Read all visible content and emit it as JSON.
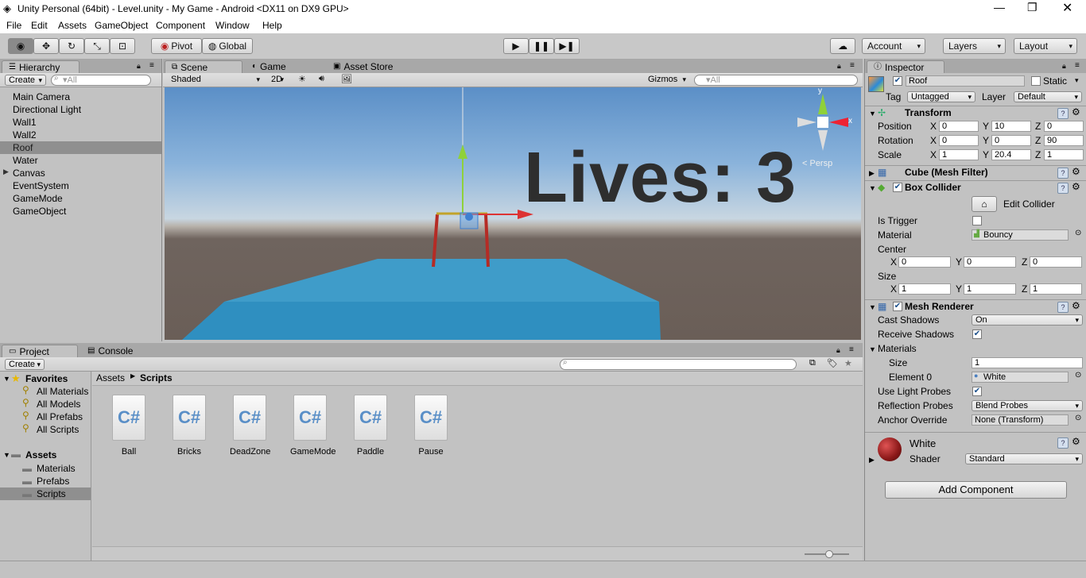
{
  "window": {
    "title": "Unity Personal (64bit) - Level.unity - My Game - Android <DX11 on DX9 GPU>"
  },
  "menu": [
    "File",
    "Edit",
    "Assets",
    "GameObject",
    "Component",
    "Window",
    "Help"
  ],
  "toolbar": {
    "pivot": "Pivot",
    "global": "Global",
    "account": "Account",
    "layers": "Layers",
    "layout": "Layout"
  },
  "hierarchy": {
    "tab": "Hierarchy",
    "create": "Create",
    "search_placeholder": "▾All",
    "items": [
      "Main Camera",
      "Directional Light",
      "Wall1",
      "Wall2",
      "Roof",
      "Water",
      "Canvas",
      "EventSystem",
      "GameMode",
      "GameObject"
    ],
    "selected": "Roof"
  },
  "scene": {
    "tabs": [
      "Scene",
      "Game",
      "Asset Store"
    ],
    "shading": "Shaded",
    "mode_2d": "2D",
    "gizmos": "Gizmos",
    "search_placeholder": "▾All",
    "overlay_text": "Lives: 3",
    "persp": "< Persp",
    "axes": {
      "y": "y",
      "x": "x"
    }
  },
  "project": {
    "tabs": [
      "Project",
      "Console"
    ],
    "create": "Create",
    "favorites_label": "Favorites",
    "favorites": [
      "All Materials",
      "All Models",
      "All Prefabs",
      "All Scripts"
    ],
    "assets_label": "Assets",
    "assets": [
      "Materials",
      "Prefabs",
      "Scripts"
    ],
    "breadcrumb": [
      "Assets",
      "Scripts"
    ],
    "files": [
      "Ball",
      "Bricks",
      "DeadZone",
      "GameMode",
      "Paddle",
      "Pause"
    ],
    "file_glyph": "C#"
  },
  "inspector": {
    "tab": "Inspector",
    "name": "Roof",
    "static": "Static",
    "tag_label": "Tag",
    "tag": "Untagged",
    "layer_label": "Layer",
    "layer": "Default",
    "transform": {
      "title": "Transform",
      "rows": [
        {
          "label": "Position",
          "x": "0",
          "y": "10",
          "z": "0"
        },
        {
          "label": "Rotation",
          "x": "0",
          "y": "0",
          "z": "90"
        },
        {
          "label": "Scale",
          "x": "1",
          "y": "20.4",
          "z": "1"
        }
      ]
    },
    "mesh_filter": "Cube (Mesh Filter)",
    "box_collider": {
      "title": "Box Collider",
      "edit": "Edit Collider",
      "is_trigger": "Is Trigger",
      "material_label": "Material",
      "material": "Bouncy",
      "center_label": "Center",
      "center": {
        "x": "0",
        "y": "0",
        "z": "0"
      },
      "size_label": "Size",
      "size": {
        "x": "1",
        "y": "1",
        "z": "1"
      }
    },
    "mesh_renderer": {
      "title": "Mesh Renderer",
      "cast_shadows_label": "Cast Shadows",
      "cast_shadows": "On",
      "receive_shadows_label": "Receive Shadows",
      "materials_label": "Materials",
      "size_label": "Size",
      "size": "1",
      "element0_label": "Element 0",
      "element0": "White",
      "light_probes_label": "Use Light Probes",
      "reflection_label": "Reflection Probes",
      "reflection": "Blend Probes",
      "anchor_label": "Anchor Override",
      "anchor": "None (Transform)"
    },
    "material": {
      "name": "White",
      "shader_label": "Shader",
      "shader": "Standard"
    },
    "add_component": "Add Component",
    "colors": {
      "selection": "#8f8f8f",
      "water": "#2f8fc0",
      "roof_red": "#b52b25"
    }
  }
}
